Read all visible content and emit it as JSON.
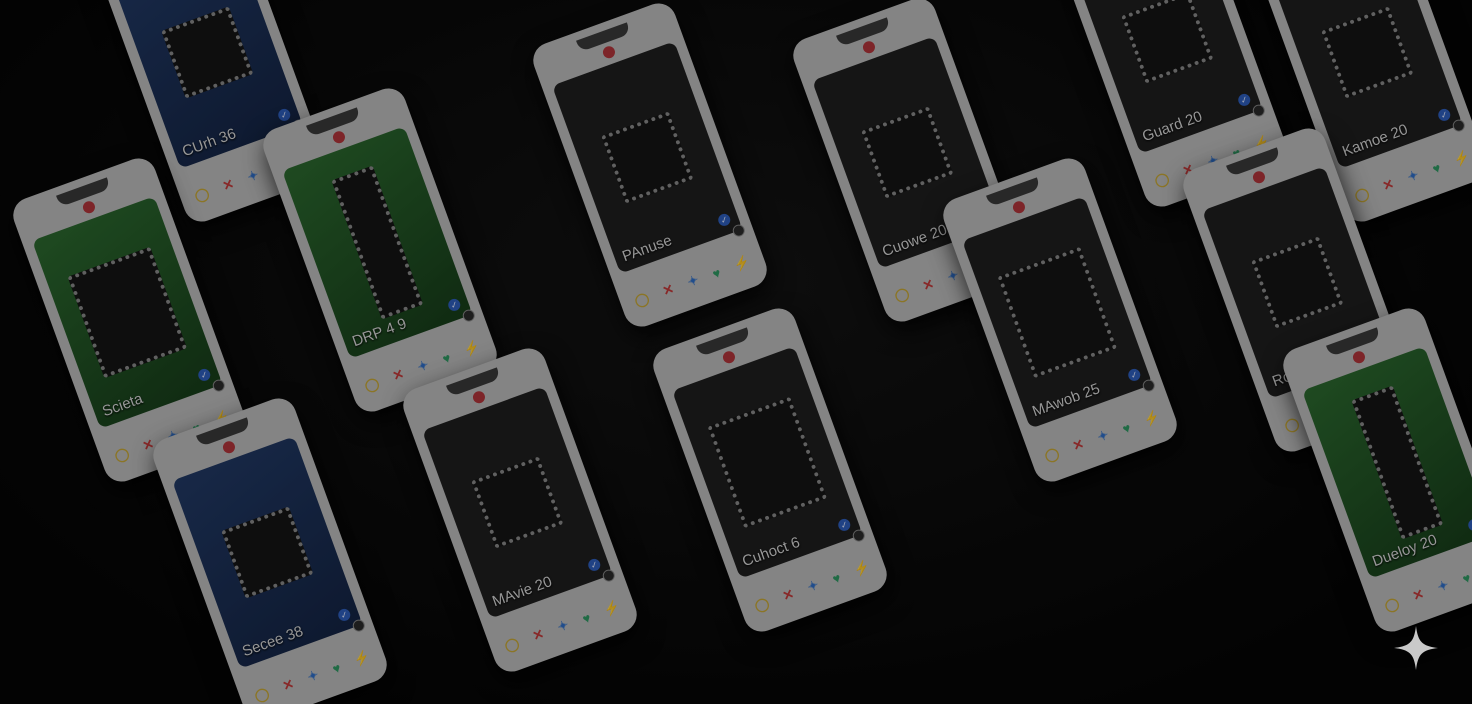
{
  "image": {
    "card_labels": [
      "CUrh 36",
      "Guard 20",
      "Kamoe 20",
      "DRP 4 9",
      "PAnuse",
      "Cuowe 20",
      "Scieta",
      "Secee 38",
      "MAvie 20",
      "Cuhoct 6",
      "MAwob 25",
      "Rogcera",
      "Dueloy 20"
    ],
    "card_actions": [
      "✕",
      "✦",
      "♥",
      "⚡"
    ],
    "colors": {
      "card": "#bdbdbd",
      "notch_dot": "#b3363b",
      "board_green": "#2c6a2f",
      "board_blue": "#223a66",
      "verified": "#2e5fbf"
    },
    "icons": [
      "heart-dot-icon",
      "close-icon",
      "star-icon",
      "heart-icon",
      "bolt-icon",
      "info-icon",
      "verified-icon",
      "sparkle-icon"
    ]
  }
}
